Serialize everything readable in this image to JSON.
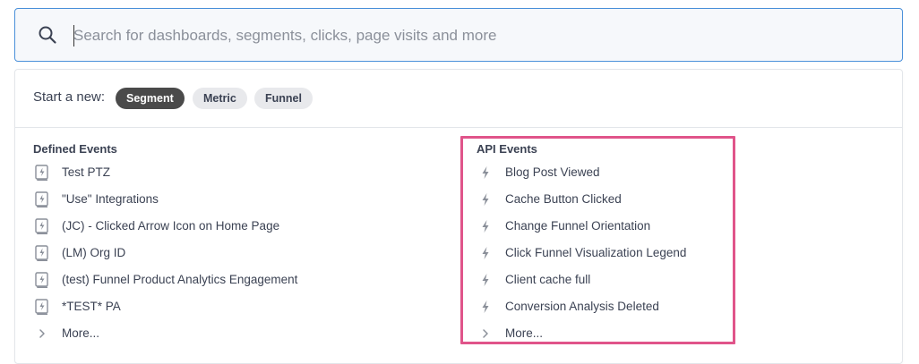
{
  "search": {
    "placeholder": "Search for dashboards, segments, clicks, page visits and more",
    "icon": "search-icon"
  },
  "start_new": {
    "label": "Start a new:",
    "chips": [
      "Segment",
      "Metric",
      "Funnel"
    ]
  },
  "defined_events": {
    "title": "Defined Events",
    "icon": "book-lightning-icon",
    "items": [
      "Test PTZ",
      "\"Use\" Integrations",
      "(JC) - Clicked Arrow Icon on Home Page",
      "(LM) Org ID",
      "(test) Funnel Product Analytics Engagement",
      "*TEST* PA"
    ],
    "more": "More..."
  },
  "api_events": {
    "title": "API Events",
    "icon": "lightning-icon",
    "items": [
      "Blog Post Viewed",
      "Cache Button Clicked",
      "Change Funnel Orientation",
      "Click Funnel Visualization Legend",
      "Client cache full",
      "Conversion Analysis Deleted"
    ],
    "more": "More..."
  },
  "colors": {
    "highlight": "#e0548a",
    "search_border": "#4a90d9",
    "chip_active": "#4a4a4a"
  }
}
